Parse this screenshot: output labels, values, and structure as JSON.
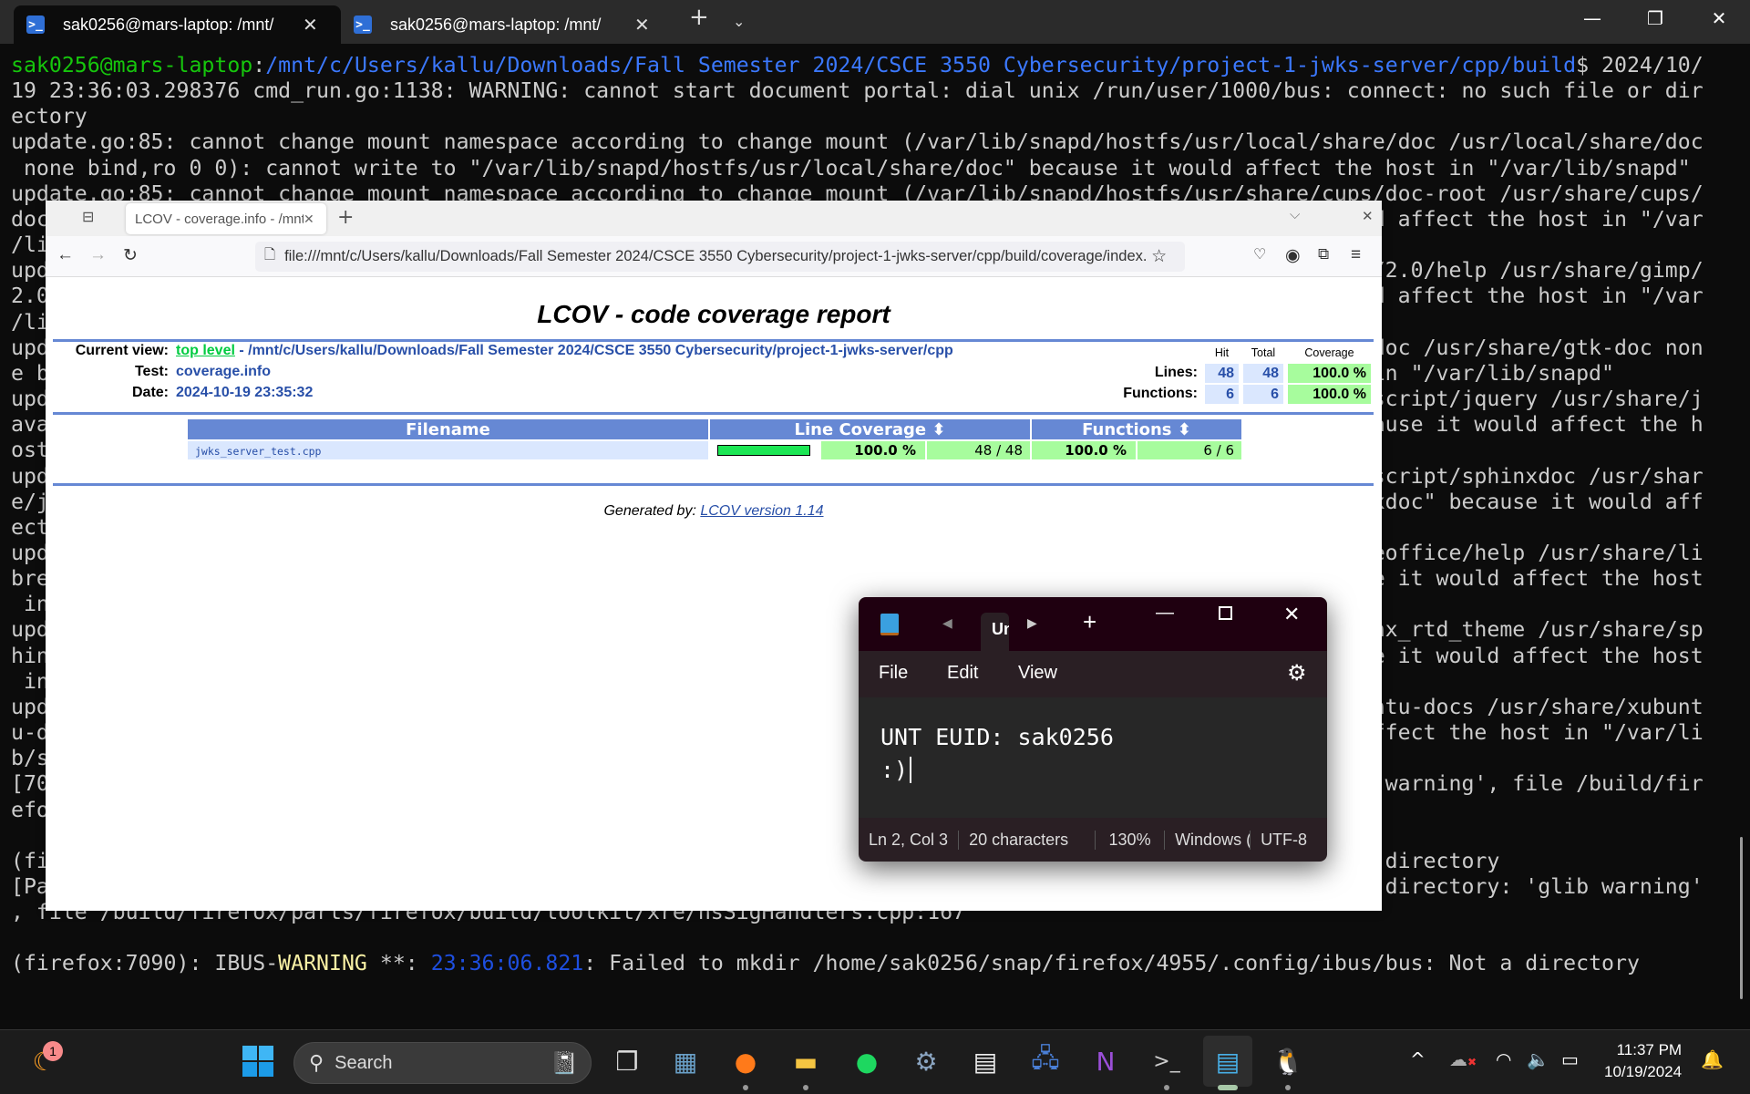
{
  "terminal": {
    "tabs": [
      {
        "label": "sak0256@mars-laptop: /mnt/"
      },
      {
        "label": "sak0256@mars-laptop: /mnt/"
      }
    ],
    "prompt": {
      "user": "sak0256@mars-laptop",
      "sep": ":",
      "path": "/mnt/c/Users/kallu/Downloads/Fall Semester 2024/CSCE 3550 Cybersecurity/project-1-jwks-server/cpp/build",
      "rest": "$ 2024/10/"
    },
    "lines": [
      {
        "l": "19 23:36:03.298376 cmd_run.go:1138: WARNING: cannot start document portal: dial unix /run/user/1000/bus: connect: no such file or dir",
        "r": ""
      },
      {
        "l": "ectory",
        "r": ""
      },
      {
        "l": "update.go:85: cannot change mount namespace according to change mount (/var/lib/snapd/hostfs/usr/local/share/doc /usr/local/share/doc",
        "r": ""
      },
      {
        "l": " none bind,ro 0 0): cannot write to \"/var/lib/snapd/hostfs/usr/local/share/doc\" because it would affect the host in \"/var/lib/snapd\"",
        "r": ""
      },
      {
        "l": "update.go:85: cannot change mount namespace according to change mount (/var/lib/snapd/hostfs/usr/share/cups/doc-root /usr/share/cups/",
        "r": ""
      },
      {
        "l": "doc",
        "r": "d affect the host in \"/var"
      },
      {
        "l": "/li",
        "r": ""
      },
      {
        "l": "upd",
        "r": "/2.0/help /usr/share/gimp/"
      },
      {
        "l": "2.0",
        "r": "d affect the host in \"/var"
      },
      {
        "l": "/li",
        "r": ""
      },
      {
        "l": "upd",
        "r": "doc /usr/share/gtk-doc non"
      },
      {
        "l": "e b",
        "r": "in \"/var/lib/snapd\""
      },
      {
        "l": "upd",
        "r": "script/jquery /usr/share/j"
      },
      {
        "l": "ava",
        "r": "ause it would affect the h"
      },
      {
        "l": "ost",
        "r": ""
      },
      {
        "l": "upd",
        "r": "script/sphinxdoc /usr/shar"
      },
      {
        "l": "e/j",
        "r": "xdoc\" because it would aff"
      },
      {
        "l": "ect",
        "r": ""
      },
      {
        "l": "upd",
        "r": "eoffice/help /usr/share/li"
      },
      {
        "l": "bre",
        "r": "e it would affect the host"
      },
      {
        "l": " in",
        "r": ""
      },
      {
        "l": "upd",
        "r": "nx_rtd_theme /usr/share/sp"
      },
      {
        "l": "hin",
        "r": "e it would affect the host"
      },
      {
        "l": " in",
        "r": ""
      },
      {
        "l": "upd",
        "r": "ntu-docs /usr/share/xubunt"
      },
      {
        "l": "u-d",
        "r": "ffect the host in \"/var/li"
      },
      {
        "l": "b/s",
        "r": ""
      },
      {
        "l": "[70",
        "r": " warning', file /build/fir"
      },
      {
        "l": "efo",
        "r": ""
      },
      {
        "l": "",
        "r": ""
      },
      {
        "l": "(fi",
        "r": " directory"
      },
      {
        "l": "[Pa",
        "r": " directory: 'glib warning'"
      },
      {
        "l": ", file /build/firefox/parts/firefox/build/toolkit/xre/nsSigHandlers.cpp:167",
        "r": ""
      },
      {
        "l": "",
        "r": ""
      }
    ],
    "ibus": {
      "a": "(firefox:7090): IBUS-",
      "warn": "WARNING",
      "b": " **: ",
      "time": "23:36:06.821",
      "c": ": Failed to mkdir /home/sak0256/snap/firefox/4955/.config/ibus/bus: Not a directory"
    }
  },
  "firefox": {
    "tab_title": "LCOV - coverage.info - /mnt/c/Users/kallu",
    "url": "file:///mnt/c/Users/kallu/Downloads/Fall Semester 2024/CSCE 3550 Cybersecurity/project-1-jwks-server/cpp/build/coverage/index.html",
    "page": {
      "title": "LCOV - code coverage report",
      "current_view_label": "Current view:",
      "top_level": "top level",
      "current_view_path": " - /mnt/c/Users/kallu/Downloads/Fall Semester 2024/CSCE 3550 Cybersecurity/project-1-jwks-server/cpp",
      "test_label": "Test:",
      "test_value": "coverage.info",
      "date_label": "Date:",
      "date_value": "2024-10-19 23:35:32",
      "stats_headers": {
        "hit": "Hit",
        "total": "Total",
        "coverage": "Coverage"
      },
      "lines": {
        "label": "Lines:",
        "hit": "48",
        "total": "48",
        "coverage": "100.0 %"
      },
      "functions": {
        "label": "Functions:",
        "hit": "6",
        "total": "6",
        "coverage": "100.0 %"
      },
      "table": {
        "headers": {
          "filename": "Filename",
          "line_coverage": "Line Coverage ⬍",
          "functions": "Functions ⬍"
        },
        "rows": [
          {
            "file": "jwks_server_test.cpp",
            "line_pct": "100.0 %",
            "line_count": "48 / 48",
            "line_fraction": 1.0,
            "func_pct": "100.0 %",
            "func_count": "6 / 6"
          }
        ]
      },
      "generated_label": "Generated by: ",
      "generated_link": "LCOV version 1.14"
    }
  },
  "notepad": {
    "tab": "Untitled",
    "menu": {
      "file": "File",
      "edit": "Edit",
      "view": "View"
    },
    "text_line1": "UNT EUID: sak0256",
    "text_line2": ":)",
    "status": {
      "position": "Ln 2, Col 3",
      "chars": "20 characters",
      "zoom": "130%",
      "eol": "Windows (CRLF)",
      "encoding": "UTF-8"
    }
  },
  "taskbar": {
    "search_placeholder": "Search",
    "notification_badge": "1",
    "time": "11:37 PM",
    "date": "10/19/2024"
  }
}
